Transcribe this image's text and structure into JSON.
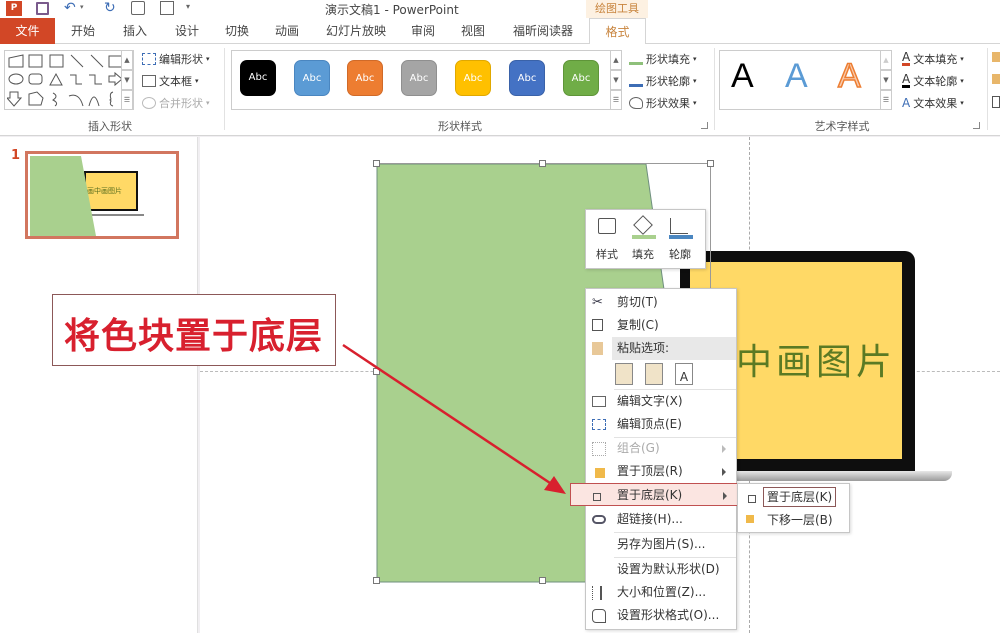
{
  "window": {
    "title": "演示文稿1 - PowerPoint",
    "context_tool": "绘图工具"
  },
  "quick_access": [
    {
      "name": "ppt-logo-icon"
    },
    {
      "name": "save-icon"
    },
    {
      "name": "undo-icon"
    },
    {
      "name": "redo-icon"
    },
    {
      "name": "slideshow-from-start-icon"
    },
    {
      "name": "present-online-icon"
    },
    {
      "name": "customize-qat-icon"
    }
  ],
  "tabs": [
    {
      "label": "文件",
      "active": false,
      "file": true
    },
    {
      "label": "开始"
    },
    {
      "label": "插入"
    },
    {
      "label": "设计"
    },
    {
      "label": "切换"
    },
    {
      "label": "动画"
    },
    {
      "label": "幻灯片放映"
    },
    {
      "label": "审阅"
    },
    {
      "label": "视图"
    },
    {
      "label": "福昕阅读器"
    },
    {
      "label": "格式",
      "active": true
    }
  ],
  "ribbon": {
    "insert_shapes": {
      "label": "插入形状",
      "edit_shape": "编辑形状",
      "text_box": "文本框",
      "merge_shapes": "合并形状"
    },
    "shape_styles": {
      "label": "形状样式",
      "swatch_text": "Abc",
      "swatches": [
        "#000000",
        "#5b9bd5",
        "#ed7d31",
        "#a5a5a5",
        "#ffc000",
        "#4472c4",
        "#70ad47"
      ],
      "fill": "形状填充",
      "outline": "形状轮廓",
      "effects": "形状效果"
    },
    "wordart_styles": {
      "label": "艺术字样式",
      "sample": "A",
      "text_fill": "文本填充",
      "text_outline": "文本轮廓",
      "text_effects": "文本效果"
    }
  },
  "thumbnail": {
    "number": "1",
    "caption": "在画中画图片"
  },
  "annotation": {
    "text": "将色块置于底层"
  },
  "slide": {
    "laptop_text": "中画图片"
  },
  "mini_toolbar": {
    "style": "样式",
    "fill": "填充",
    "outline": "轮廓"
  },
  "context_menu": {
    "items": [
      {
        "label": "剪切(T)",
        "icon": "cut-icon"
      },
      {
        "label": "复制(C)",
        "icon": "copy-icon"
      },
      {
        "label": "粘贴选项:",
        "icon": "paste-icon",
        "header": true
      },
      {
        "label": "编辑文字(X)",
        "icon": "edit-text-icon"
      },
      {
        "label": "编辑顶点(E)",
        "icon": "edit-points-icon"
      },
      {
        "label": "组合(G)",
        "icon": "group-icon",
        "disabled": true,
        "submenu": true
      },
      {
        "label": "置于顶层(R)",
        "icon": "bring-to-front-icon",
        "submenu": true
      },
      {
        "label": "置于底层(K)",
        "icon": "send-to-back-icon",
        "submenu": true,
        "highlighted": true
      },
      {
        "label": "超链接(H)...",
        "icon": "hyperlink-icon"
      },
      {
        "label": "另存为图片(S)..."
      },
      {
        "label": "设置为默认形状(D)"
      },
      {
        "label": "大小和位置(Z)...",
        "icon": "size-position-icon"
      },
      {
        "label": "设置形状格式(O)...",
        "icon": "format-shape-icon"
      }
    ]
  },
  "submenu": {
    "items": [
      {
        "label": "置于底层(K)",
        "highlighted": true
      },
      {
        "label": "下移一层(B)"
      }
    ]
  }
}
